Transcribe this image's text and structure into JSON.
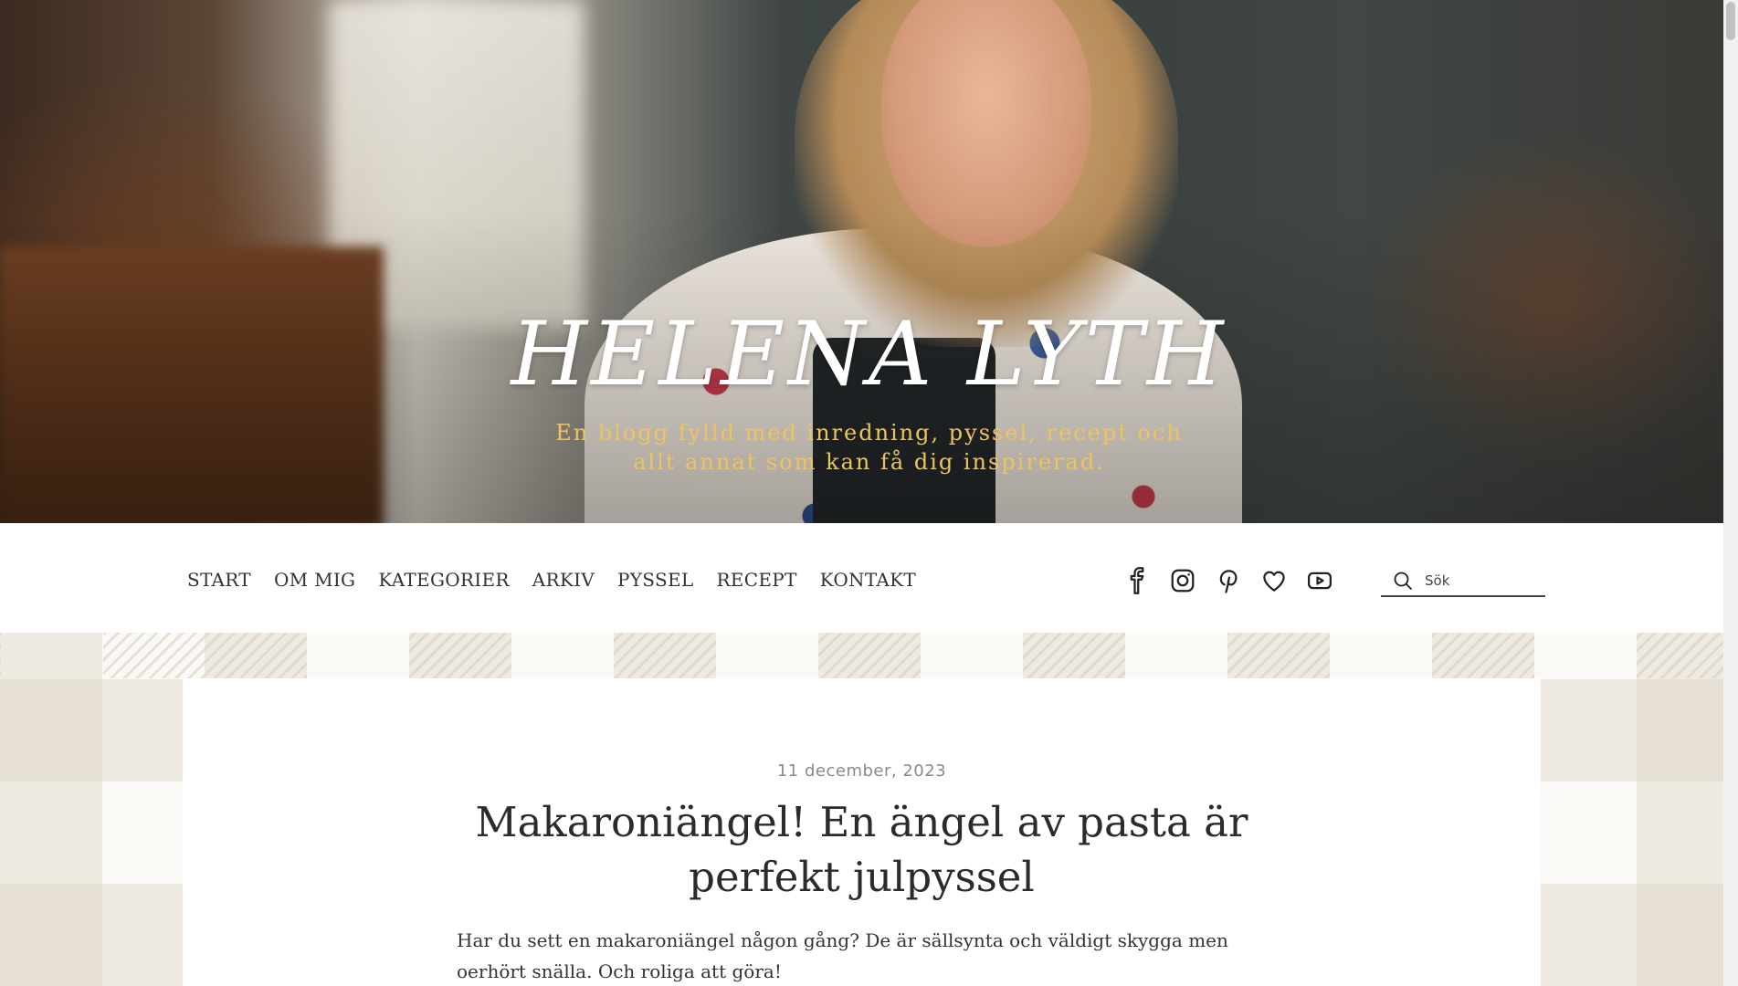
{
  "header": {
    "site_title": "HELENA LYTH",
    "tagline": "En blogg fylld med inredning, pyssel, recept och allt annat som kan få dig inspirerad."
  },
  "nav": {
    "items": [
      {
        "label": "START"
      },
      {
        "label": "OM MIG"
      },
      {
        "label": "KATEGORIER"
      },
      {
        "label": "ARKIV"
      },
      {
        "label": "PYSSEL"
      },
      {
        "label": "RECEPT"
      },
      {
        "label": "KONTAKT"
      }
    ]
  },
  "social": {
    "icons": [
      "facebook-icon",
      "instagram-icon",
      "pinterest-icon",
      "heart-icon",
      "youtube-icon"
    ]
  },
  "search": {
    "placeholder": "Sök",
    "icon": "search-icon"
  },
  "post": {
    "date": "11 december, 2023",
    "title": "Makaroniängel! En ängel av pasta är perfekt julpyssel",
    "excerpt": "Har du sett en makaroniängel någon gång? De är sällsynta och väldigt skygga men oerhört snälla. Och roliga att göra!"
  },
  "colors": {
    "tagline": "#efc45f",
    "title": "#ffffff",
    "nav_text": "#333333",
    "date": "#8a8a8a"
  }
}
